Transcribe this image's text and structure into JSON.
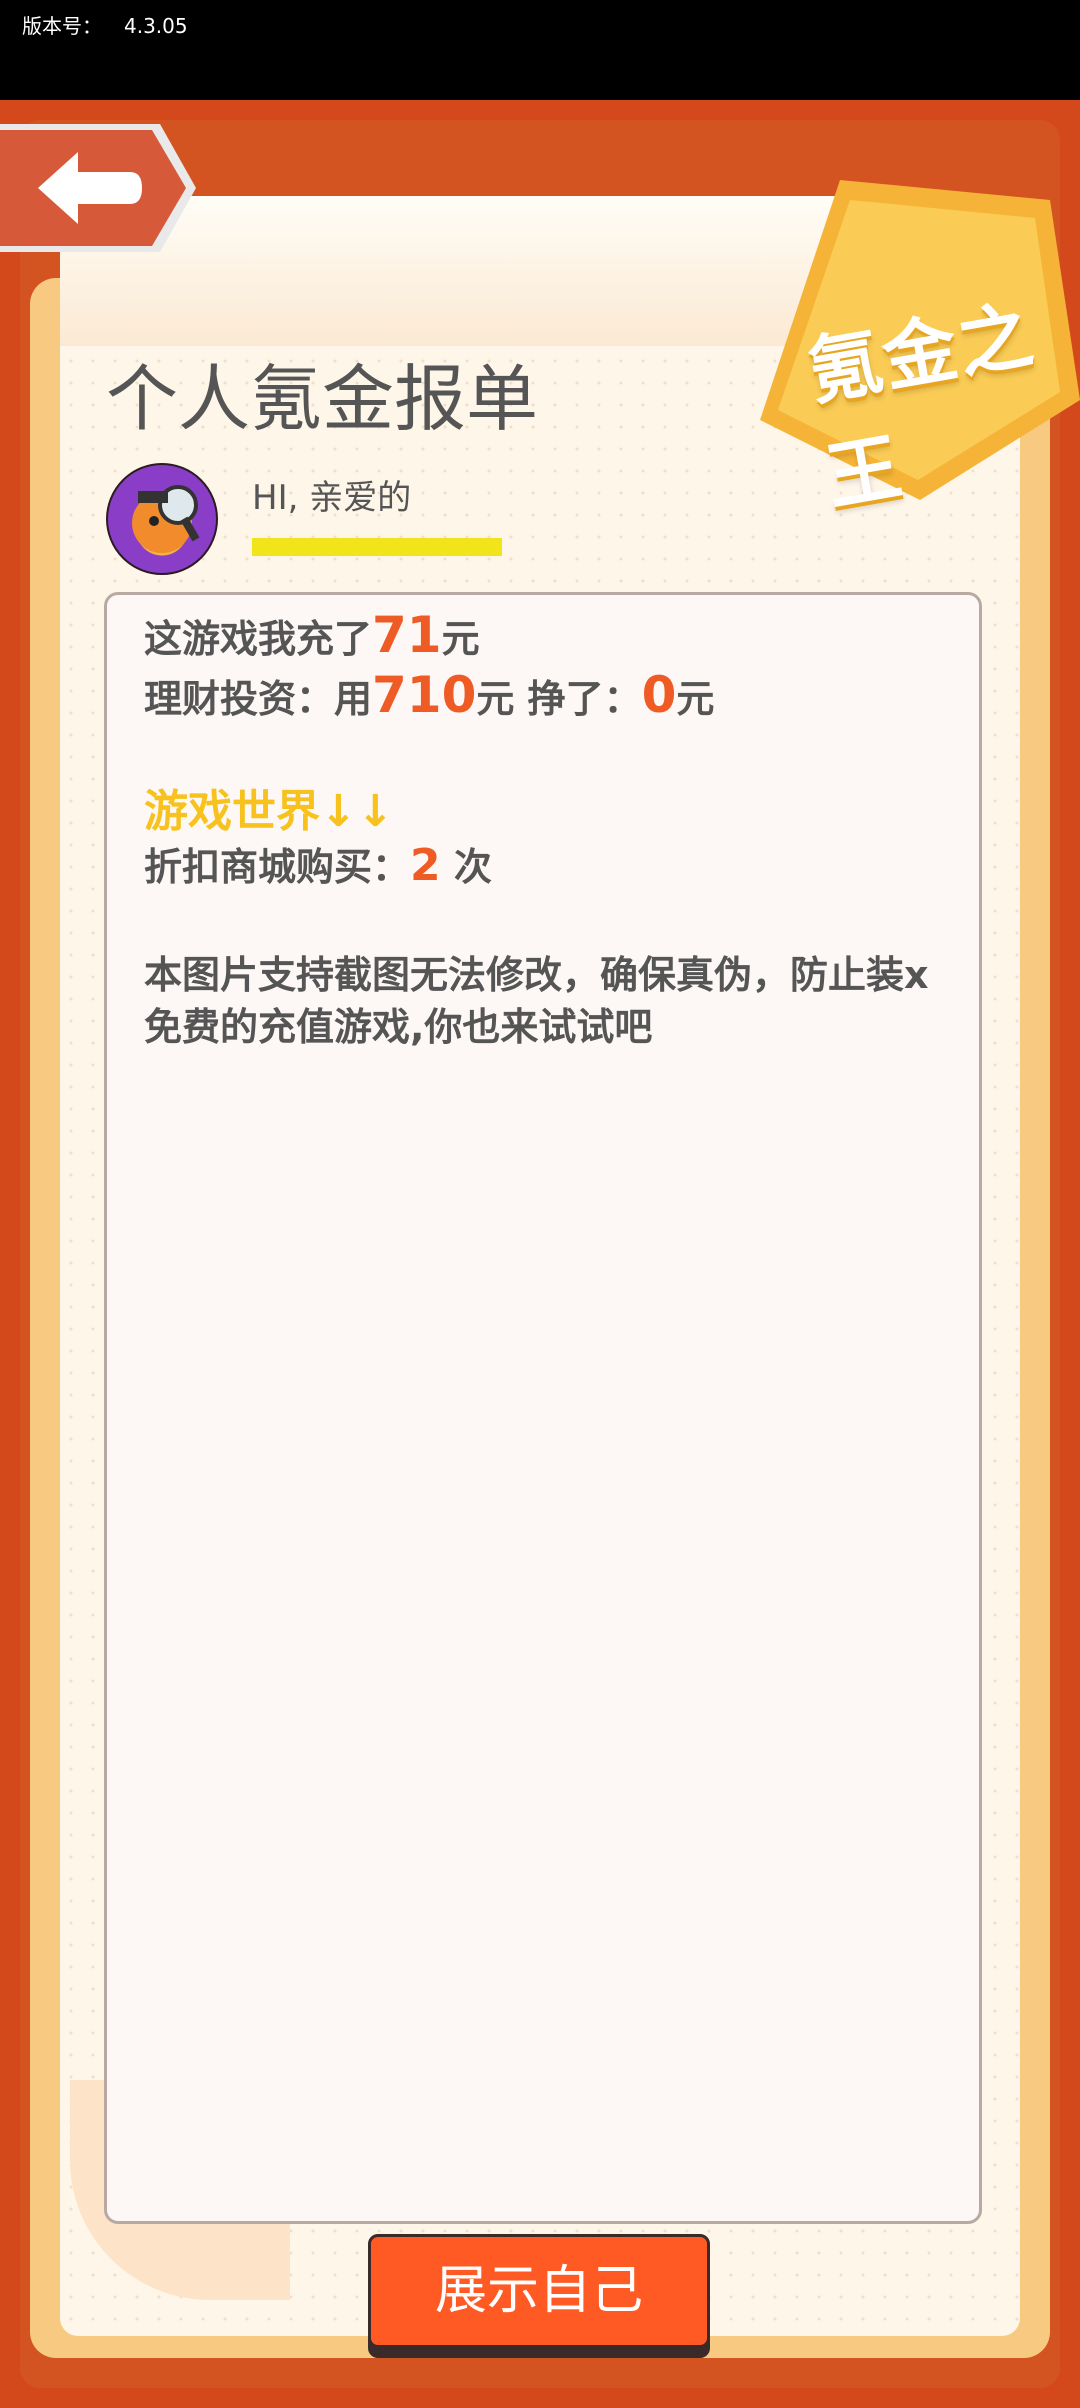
{
  "status_bar": {
    "version_label": "版本号：",
    "version_value": "4.3.05"
  },
  "badge": {
    "text": "氪金之王"
  },
  "header": {
    "title": "个人氪金报单"
  },
  "user": {
    "greeting": "HI, 亲爱的",
    "avatar": "character-avatar"
  },
  "report": {
    "line1_prefix": "这游戏我充了",
    "line1_value": "71",
    "line1_suffix": "元",
    "line2_prefix": "理财投资：用",
    "line2_value": "710",
    "line2_mid": "元 挣了：",
    "line2_value2": "0",
    "line2_suffix": "元",
    "section_title": "游戏世界↓↓",
    "line3_prefix": "折扣商城购买：",
    "line3_value": "2",
    "line3_suffix": " 次",
    "note_line1": "本图片支持截图无法修改，确保真伪，防止装x",
    "note_line2": "免费的充值游戏,你也来试试吧"
  },
  "actions": {
    "show_button": "展示自己"
  },
  "colors": {
    "accent": "#ff5a23",
    "frame": "#d4491b",
    "highlight": "#f7c21d"
  },
  "icons": {
    "back": "back-arrow-icon"
  }
}
